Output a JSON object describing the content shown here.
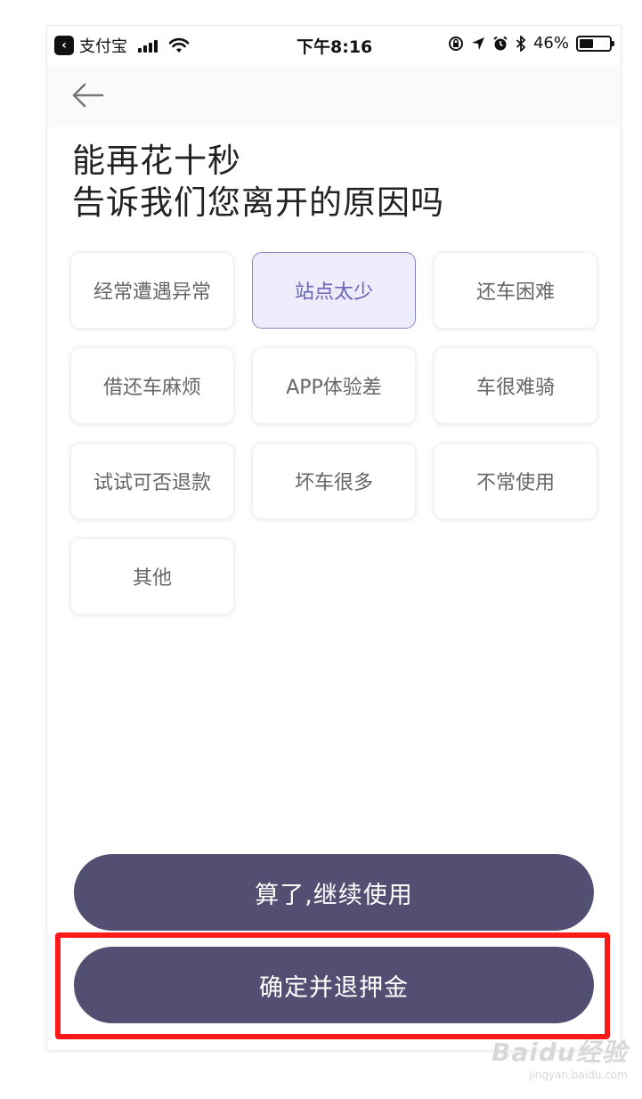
{
  "status_bar": {
    "app_name": "支付宝",
    "time": "下午8:16",
    "battery": "46%",
    "battery_level": 0.46
  },
  "title": {
    "line1": "能再花十秒",
    "line2": "告诉我们您离开的原因吗"
  },
  "reasons": [
    {
      "label": "经常遭遇异常",
      "selected": false
    },
    {
      "label": "站点太少",
      "selected": true
    },
    {
      "label": "还车困难",
      "selected": false
    },
    {
      "label": "借还车麻烦",
      "selected": false
    },
    {
      "label": "APP体验差",
      "selected": false
    },
    {
      "label": "车很难骑",
      "selected": false
    },
    {
      "label": "试试可否退款",
      "selected": false
    },
    {
      "label": "坏车很多",
      "selected": false
    },
    {
      "label": "不常使用",
      "selected": false
    },
    {
      "label": "其他",
      "selected": false
    }
  ],
  "buttons": {
    "continue_label": "算了,继续使用",
    "refund_label": "确定并退押金"
  },
  "watermark": {
    "logo": "Baidu经验",
    "url": "jingyan.baidu.com"
  },
  "colors": {
    "button_bg": "#524f72",
    "selected_bg": "#ececfa",
    "selected_text": "#6a64b6",
    "highlight": "#ff1a1a"
  }
}
